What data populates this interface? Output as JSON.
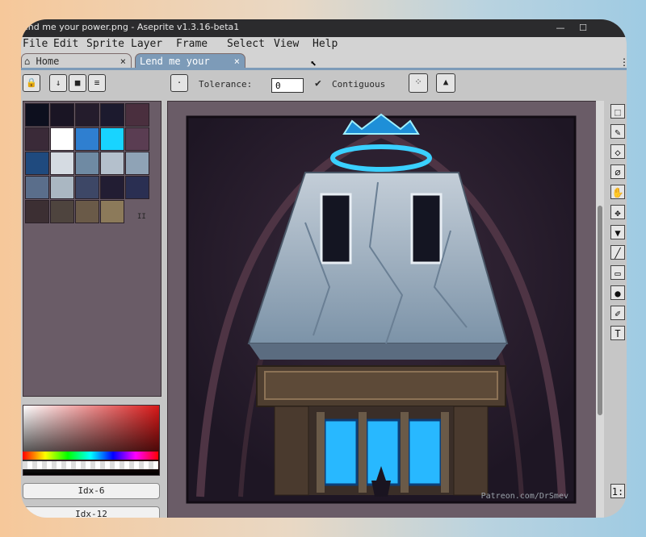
{
  "window": {
    "title": "end me your power.png - Aseprite v1.3.16-beta1"
  },
  "menu": [
    "File",
    "Edit",
    "Sprite",
    "Layer",
    "Frame",
    "Select",
    "View",
    "Help"
  ],
  "tabs": [
    {
      "label": "Home",
      "close": "×"
    },
    {
      "label": "Lend me your",
      "close": "×"
    }
  ],
  "toolbar": {
    "tolerance_label": "Tolerance:",
    "tolerance_value": "0",
    "contiguous_label": "Contiguous",
    "contiguous_check": "✔"
  },
  "palette_indicator": "II",
  "color_indices": [
    "Idx-6",
    "Idx-12"
  ],
  "canvas": {
    "watermark": "Patreon.com/DrSmev"
  },
  "colors": {
    "accent": "#7d9bb8",
    "panel": "#6a5c67",
    "glow": "#37c8ff"
  }
}
